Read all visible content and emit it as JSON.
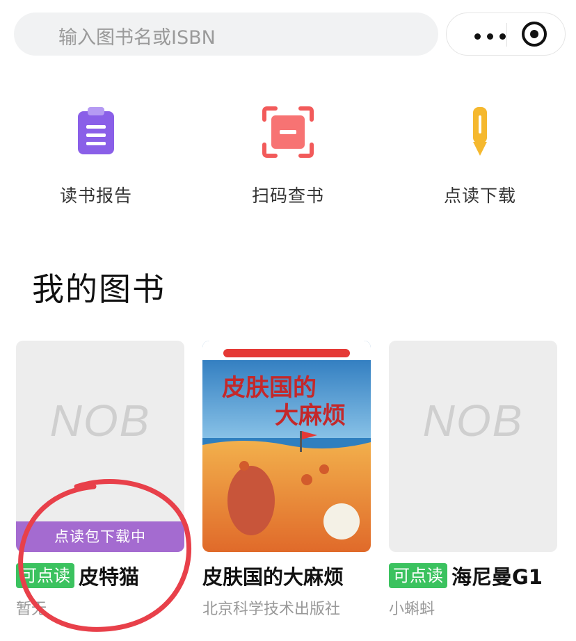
{
  "search": {
    "placeholder": "输入图书名或ISBN"
  },
  "actions": [
    {
      "label": "读书报告",
      "icon": "clipboard-icon",
      "color": "#8a5fe8"
    },
    {
      "label": "扫码查书",
      "icon": "scan-icon",
      "color": "#f25a5a"
    },
    {
      "label": "点读下载",
      "icon": "pencil-icon",
      "color": "#f5b82e"
    }
  ],
  "section_title": "我的图书",
  "books": [
    {
      "placeholder": "NOB",
      "download_status": "点读包下载中",
      "badge": "可点读",
      "title": "皮特猫",
      "author": "暂无"
    },
    {
      "cover_title_line1": "皮肤国的",
      "cover_title_line2": "大麻烦",
      "title": "皮肤国的大麻烦",
      "author": "北京科学技术出版社"
    },
    {
      "placeholder": "NOB",
      "badge": "可点读",
      "title": "海尼曼G1",
      "author": "小蝌蚪"
    }
  ],
  "colors": {
    "badge_green": "#3bc25f",
    "download_purple": "#a46bd0",
    "annotation_red": "#e8404a"
  }
}
